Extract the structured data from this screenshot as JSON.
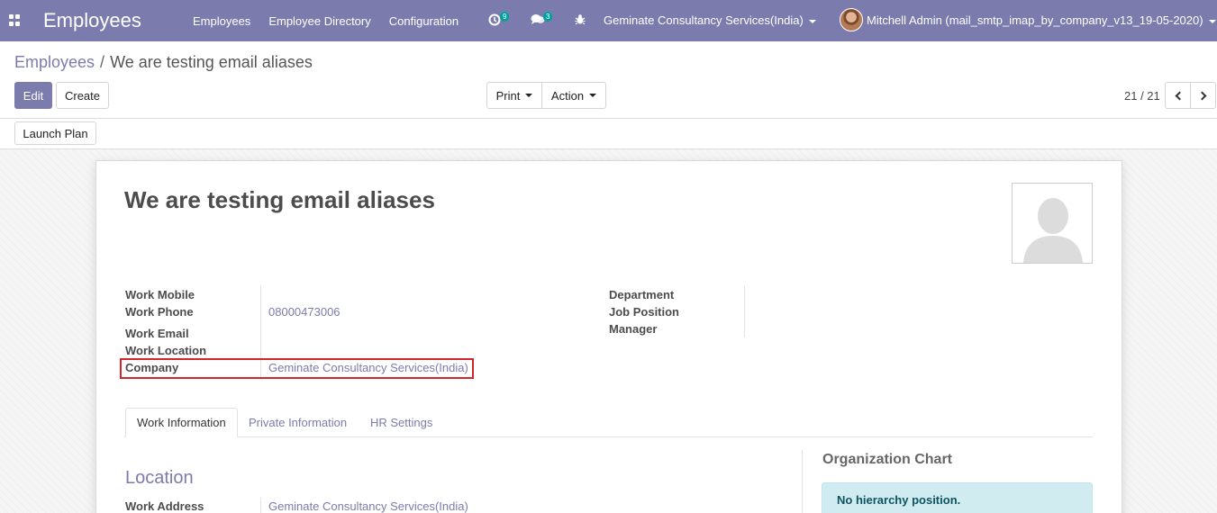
{
  "navbar": {
    "app_title": "Employees",
    "menu": [
      "Employees",
      "Employee Directory",
      "Configuration"
    ],
    "activity_count": "9",
    "messages_count": "3",
    "company_switcher": "Geminate Consultancy Services(India)",
    "user": "Mitchell Admin (mail_smtp_imap_by_company_v13_19-05-2020)",
    "accent_color": "#7c7bad"
  },
  "breadcrumb": {
    "parent": "Employees",
    "separator": "/",
    "current": "We are testing email aliases"
  },
  "buttons": {
    "edit": "Edit",
    "create": "Create",
    "print": "Print",
    "action": "Action",
    "launch_plan": "Launch Plan"
  },
  "pager": {
    "value": "21 / 21"
  },
  "employee": {
    "name": "We are testing email aliases",
    "photo_icon": "person-silhouette-icon"
  },
  "fields_left": {
    "work_mobile_label": "Work Mobile",
    "work_mobile_value": "",
    "work_phone_label": "Work Phone",
    "work_phone_value": "08000473006",
    "work_email_label": "Work Email",
    "work_email_value": "",
    "work_location_label": "Work Location",
    "work_location_value": "",
    "company_label": "Company",
    "company_value": "Geminate Consultancy Services(India)"
  },
  "fields_right": {
    "department_label": "Department",
    "job_position_label": "Job Position",
    "manager_label": "Manager"
  },
  "tabs": [
    "Work Information",
    "Private Information",
    "HR Settings"
  ],
  "work_info": {
    "section_title": "Location",
    "work_address_label": "Work Address",
    "work_address_value": "Geminate Consultancy Services(India)"
  },
  "org_chart": {
    "title": "Organization Chart",
    "message": "No hierarchy position."
  }
}
